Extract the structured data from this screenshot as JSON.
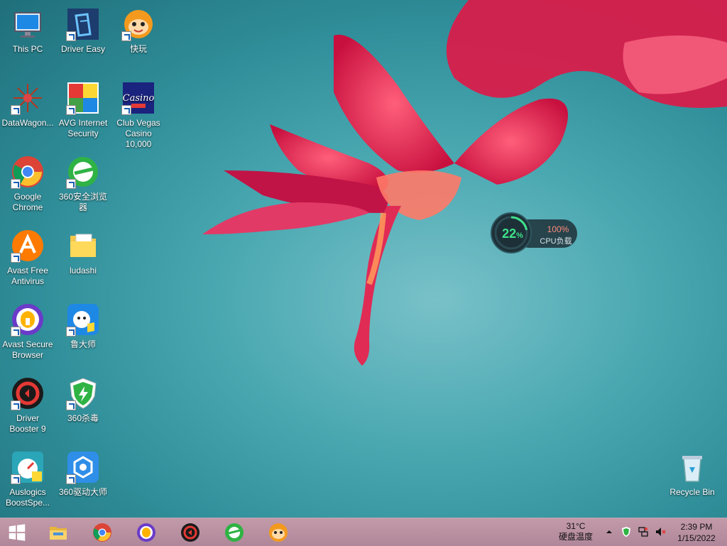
{
  "desktop": {
    "icons": [
      {
        "name": "this-pc",
        "label": "This PC"
      },
      {
        "name": "driver-easy",
        "label": "Driver Easy"
      },
      {
        "name": "kuaiwan",
        "label": "快玩"
      },
      {
        "name": "datawagon",
        "label": "DataWagon..."
      },
      {
        "name": "avg-internet-security",
        "label": "AVG Internet Security"
      },
      {
        "name": "club-vegas",
        "label": "Club Vegas Casino 10,000"
      },
      {
        "name": "google-chrome",
        "label": "Google Chrome"
      },
      {
        "name": "360-browser",
        "label": "360安全浏览器"
      },
      {
        "name": "avast-free-antivirus",
        "label": "Avast Free Antivirus"
      },
      {
        "name": "ludashi-folder",
        "label": "ludashi"
      },
      {
        "name": "avast-secure-browser",
        "label": "Avast Secure Browser"
      },
      {
        "name": "ludashi-app",
        "label": "鲁大师"
      },
      {
        "name": "driver-booster",
        "label": "Driver Booster 9"
      },
      {
        "name": "360-antivirus",
        "label": "360杀毒"
      },
      {
        "name": "auslogics-boostspeed",
        "label": "Auslogics BoostSpe..."
      },
      {
        "name": "360-driver-master",
        "label": "360驱动大师"
      },
      {
        "name": "recycle-bin",
        "label": "Recycle Bin"
      }
    ]
  },
  "cpu_widget": {
    "usage_percent": "22",
    "percent_sign": "%",
    "load_value": "100%",
    "load_label": "CPU负载",
    "ring_fraction": 0.22
  },
  "taskbar": {
    "apps": [
      "file-explorer",
      "google-chrome",
      "avast-secure-browser",
      "driver-booster",
      "360-browser",
      "kuaiwan"
    ],
    "tray": {
      "temperature": "31°C",
      "temperature_label": "硬盘温度",
      "time": "2:39 PM",
      "date": "1/15/2022"
    }
  },
  "colors": {
    "wallpaper": "#3c9ba5",
    "flower": "#e8285a",
    "taskbar": "#b98fa1",
    "cpu_green": "#3fe28c",
    "cpu_red": "#ff8a7a"
  }
}
